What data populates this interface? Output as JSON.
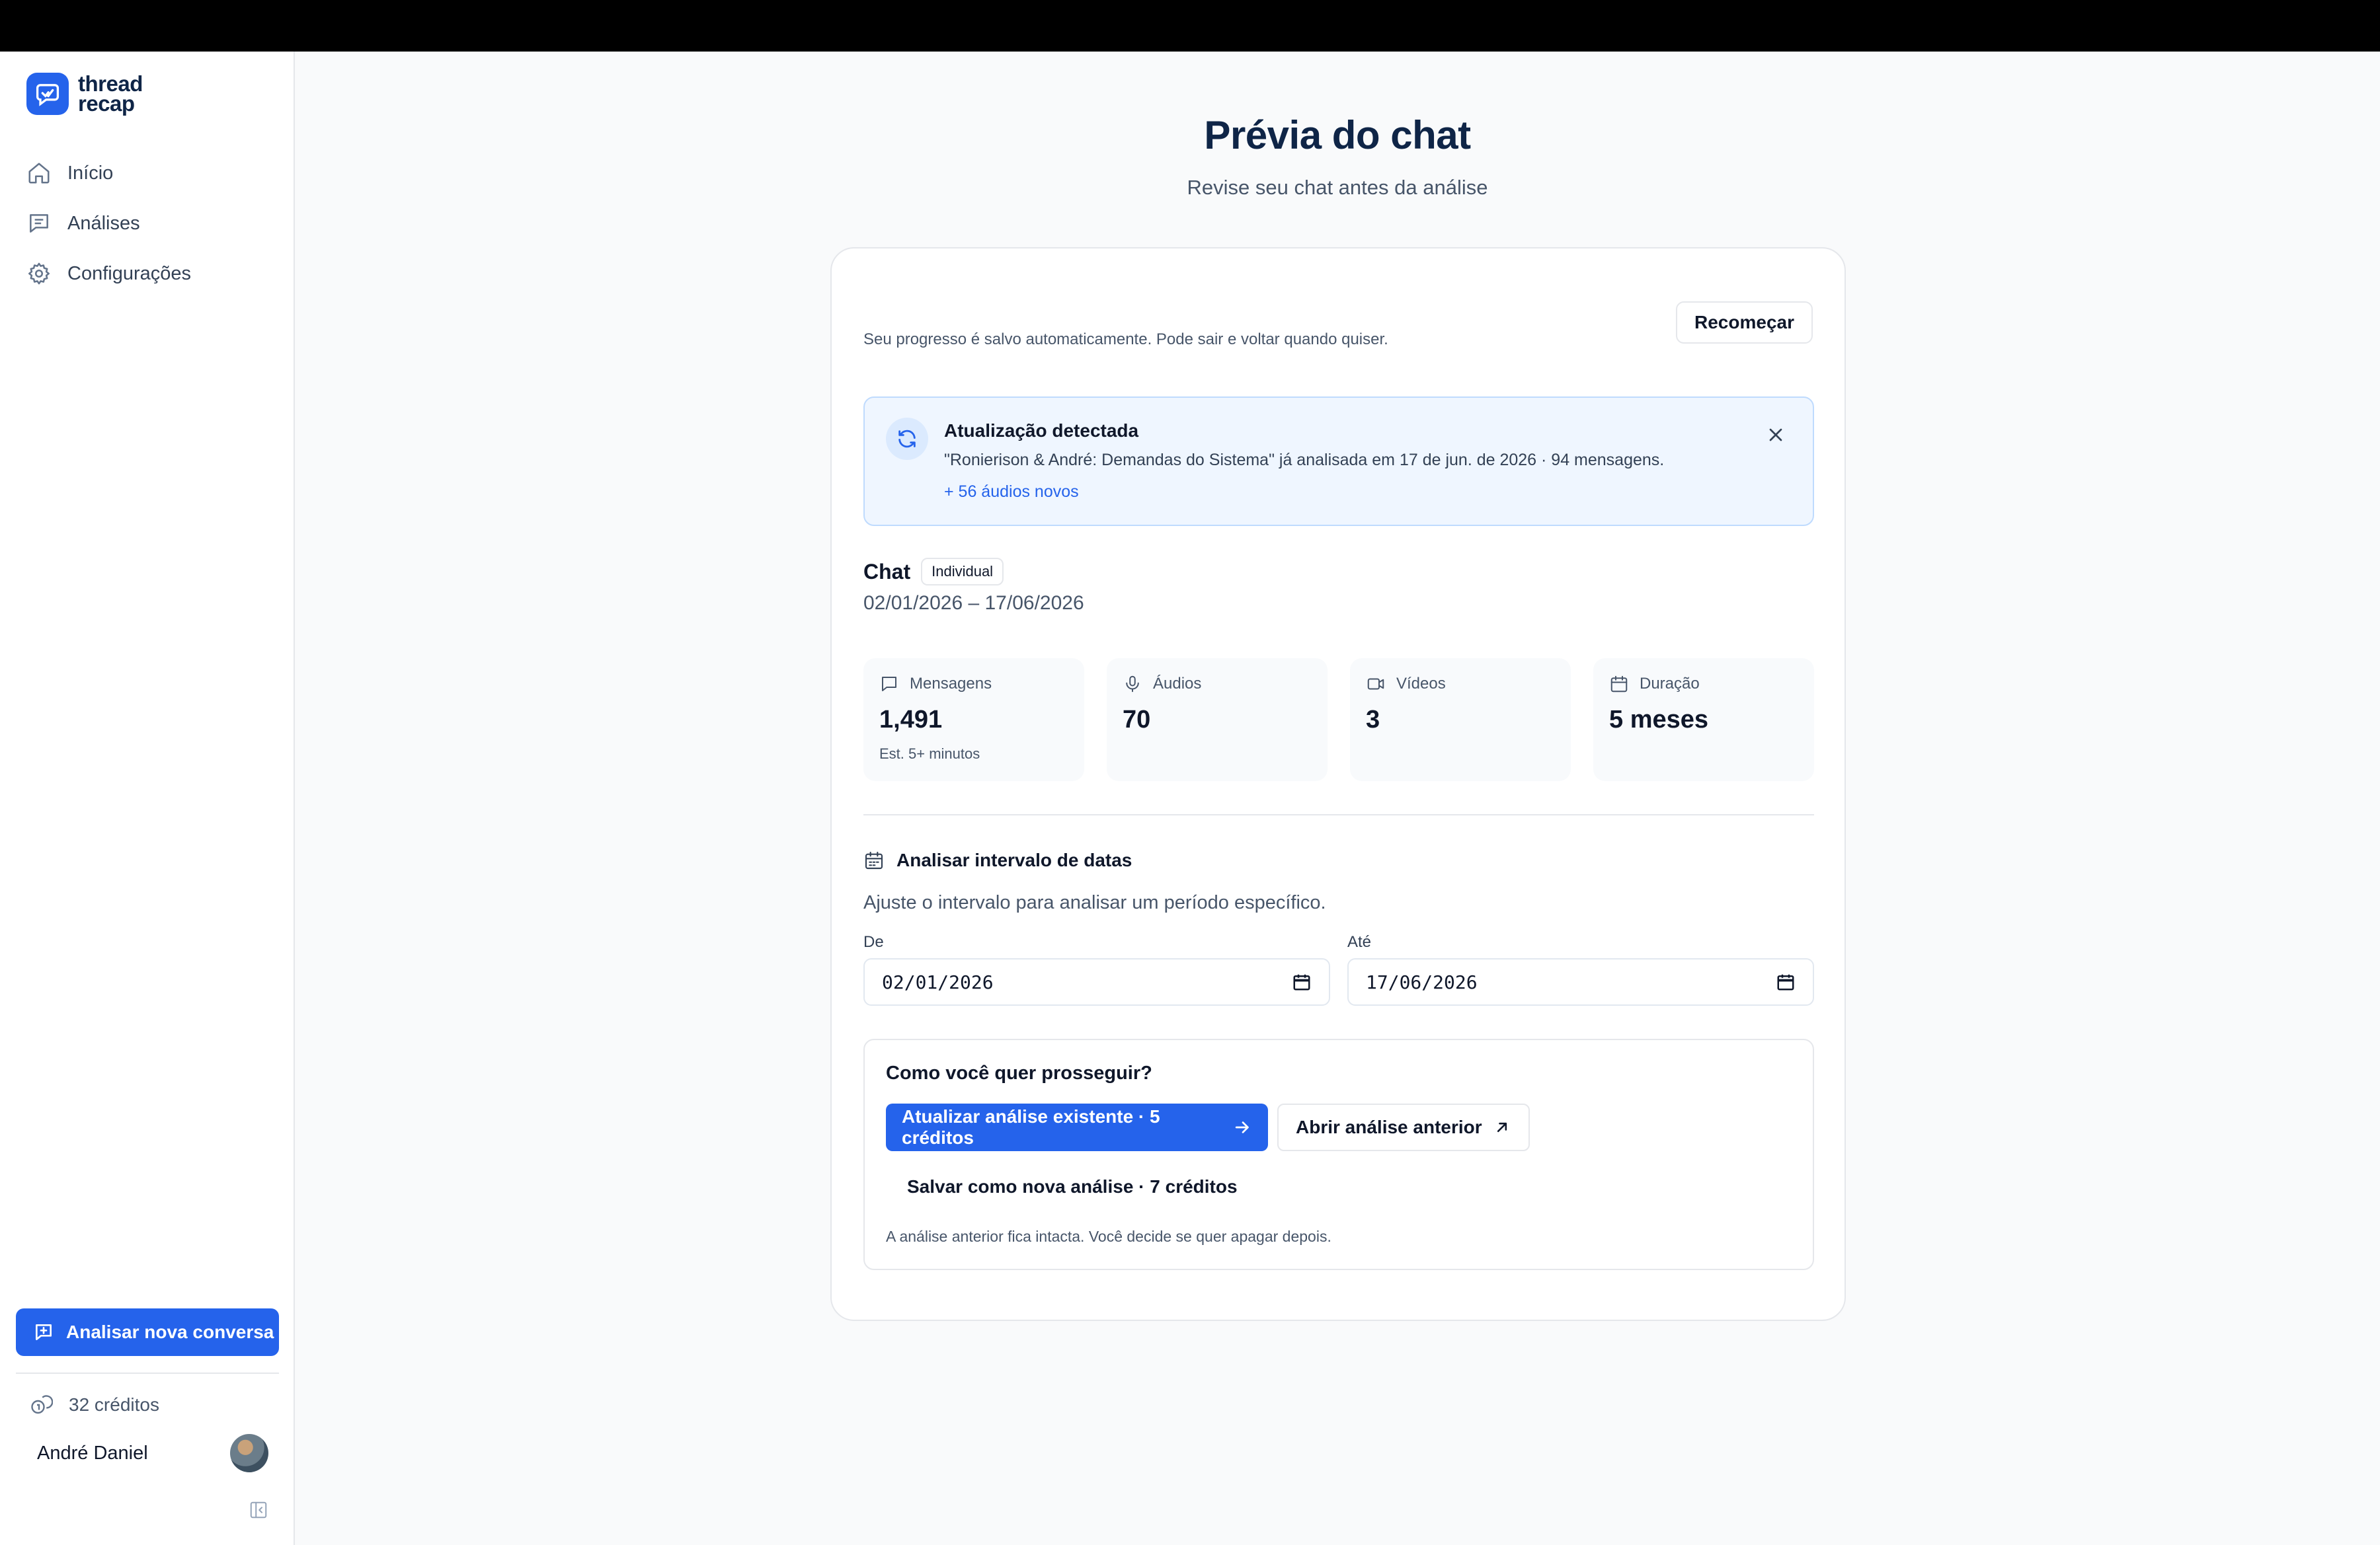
{
  "sidebar": {
    "logo": {
      "line1": "thread",
      "line2": "recap"
    },
    "nav": [
      {
        "label": "Início",
        "icon": "home-icon"
      },
      {
        "label": "Análises",
        "icon": "message-lines-icon"
      },
      {
        "label": "Configurações",
        "icon": "gear-icon"
      }
    ],
    "new_analysis_label": "Analisar nova conversa",
    "credits_label": "32 créditos",
    "user_name": "André Daniel"
  },
  "page": {
    "title": "Prévia do chat",
    "subtitle": "Revise seu chat antes da análise"
  },
  "card": {
    "progress_text": "Seu progresso é salvo automaticamente. Pode sair e voltar quando quiser.",
    "restart_label": "Recomeçar",
    "alert": {
      "title": "Atualização detectada",
      "description": "\"Ronierison & André: Demandas do Sistema\" já analisada em 17 de jun. de 2026 · 94 mensagens.",
      "link": "+ 56 áudios novos"
    },
    "chat": {
      "label": "Chat",
      "badge": "Individual",
      "date_range": "02/01/2026 – 17/06/2026"
    },
    "stats": [
      {
        "label": "Mensagens",
        "value": "1,491",
        "sub": "Est. 5+ minutos",
        "icon": "message-square-icon"
      },
      {
        "label": "Áudios",
        "value": "70",
        "sub": "",
        "icon": "microphone-icon"
      },
      {
        "label": "Vídeos",
        "value": "3",
        "sub": "",
        "icon": "video-icon"
      },
      {
        "label": "Duração",
        "value": "5 meses",
        "sub": "",
        "icon": "calendar-icon"
      }
    ],
    "range": {
      "title": "Analisar intervalo de datas",
      "description": "Ajuste o intervalo para analisar um período específico.",
      "from_label": "De",
      "from_value": "02/01/2026",
      "to_label": "Até",
      "to_value": "17/06/2026"
    },
    "proceed": {
      "question": "Como você quer prosseguir?",
      "update_label": "Atualizar análise existente · 5 créditos",
      "open_label": "Abrir análise anterior",
      "save_new_label": "Salvar como nova análise · 7 créditos",
      "note": "A análise anterior fica intacta. Você decide se quer apagar depois."
    }
  },
  "colors": {
    "accent": "#2563eb",
    "navy": "#0f2547",
    "alert_bg": "#eff6ff",
    "muted": "#475569"
  }
}
